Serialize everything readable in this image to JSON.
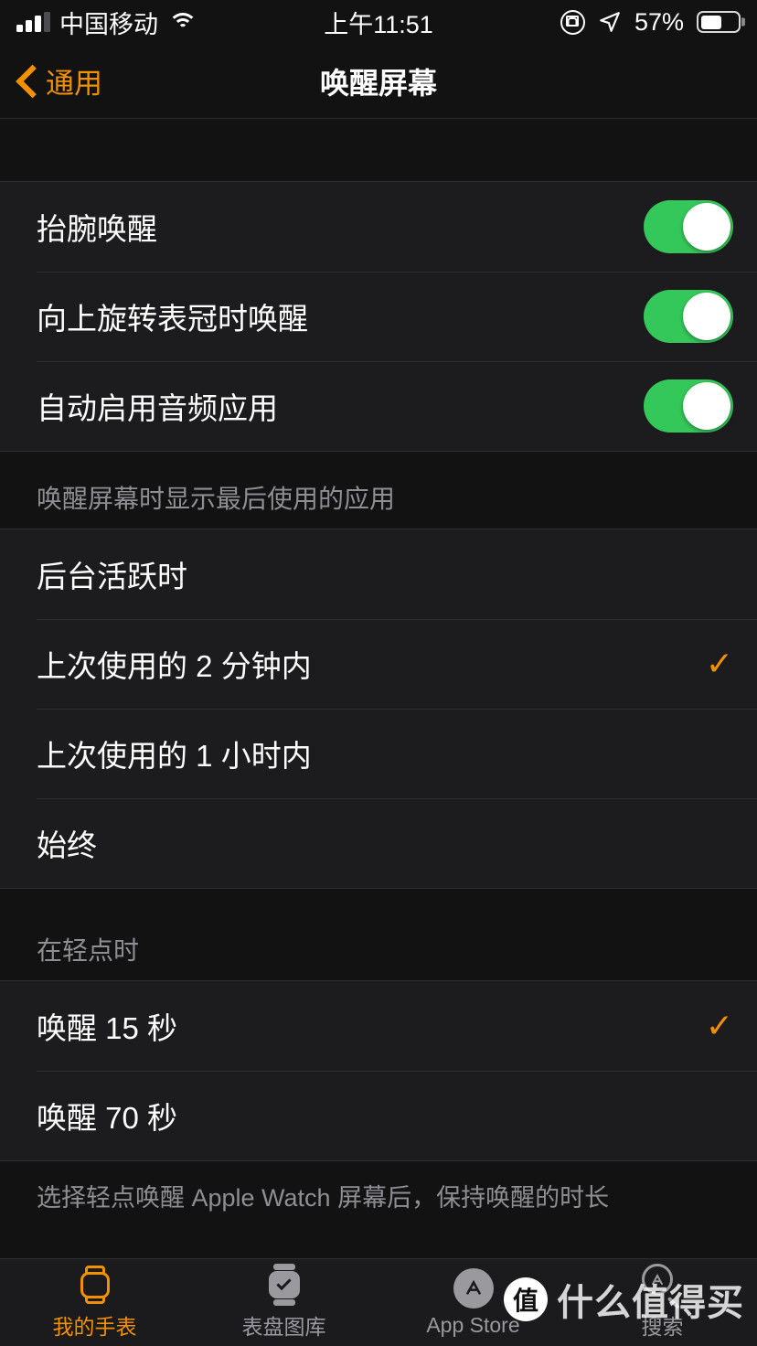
{
  "status_bar": {
    "carrier": "中国移动",
    "time": "上午11:51",
    "battery_percent": "57%",
    "signal_bars_filled": 3,
    "signal_bars_total": 4,
    "wifi_icon": "wifi-icon",
    "rotation_lock_icon": "rotation-lock-icon",
    "location_icon": "location-arrow-icon",
    "battery_icon": "battery-icon"
  },
  "nav": {
    "back_label": "通用",
    "back_icon": "chevron-left-icon",
    "title": "唤醒屏幕"
  },
  "colors": {
    "accent_orange": "#F29100",
    "toggle_on_green": "#34C759",
    "row_background": "#1C1C1E",
    "page_background": "#121212",
    "separator": "#2F2F31",
    "secondary_text": "#8E8E93"
  },
  "toggles_group": {
    "rows": [
      {
        "label": "抬腕唤醒",
        "on": true
      },
      {
        "label": "向上旋转表冠时唤醒",
        "on": true
      },
      {
        "label": "自动启用音频应用",
        "on": true
      }
    ]
  },
  "last_app_group": {
    "header": "唤醒屏幕时显示最后使用的应用",
    "rows": [
      {
        "label": "后台活跃时",
        "selected": false
      },
      {
        "label": "上次使用的 2 分钟内",
        "selected": true
      },
      {
        "label": "上次使用的 1 小时内",
        "selected": false
      },
      {
        "label": "始终",
        "selected": false
      }
    ]
  },
  "on_tap_group": {
    "header": "在轻点时",
    "rows": [
      {
        "label": "唤醒 15 秒",
        "selected": true
      },
      {
        "label": "唤醒 70 秒",
        "selected": false
      }
    ],
    "footer": "选择轻点唤醒 Apple Watch 屏幕后，保持唤醒的时长"
  },
  "checkmark_glyph": "✓",
  "tab_bar": {
    "tabs": [
      {
        "label": "我的手表",
        "icon": "watch-icon",
        "active": true
      },
      {
        "label": "表盘图库",
        "icon": "watch-face-gallery-icon",
        "active": false
      },
      {
        "label": "App Store",
        "icon": "app-store-icon",
        "active": false
      },
      {
        "label": "搜索",
        "icon": "search-icon",
        "active": false
      }
    ]
  },
  "watermark": {
    "logo_char": "值",
    "text": "什么值得买"
  }
}
